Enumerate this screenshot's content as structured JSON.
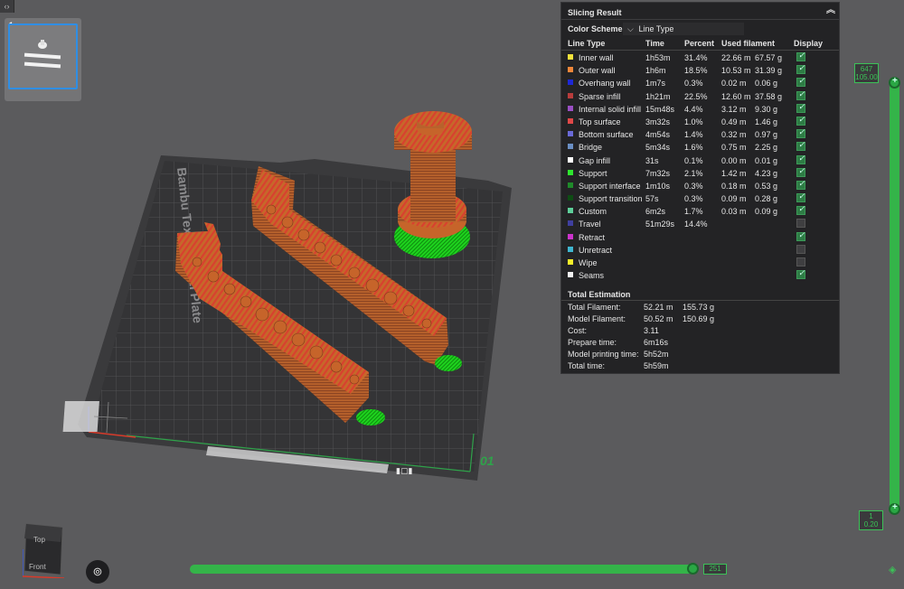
{
  "sidebar": {
    "toggle": "‹›"
  },
  "plate_thumbnail": {
    "number": "1"
  },
  "bed": {
    "label": "Bambu Textured PEI Plate",
    "plate_number": "01"
  },
  "panel": {
    "title": "Slicing Result",
    "color_scheme_label": "Color Scheme",
    "color_scheme_value": "Line Type",
    "columns": {
      "type": "Line Type",
      "time": "Time",
      "percent": "Percent",
      "used": "Used filament",
      "display": "Display"
    },
    "rows": [
      {
        "name": "Inner wall",
        "color": "#f3e23b",
        "time": "1h53m",
        "pct": "31.4%",
        "m": "22.66 m",
        "g": "67.57 g",
        "on": true
      },
      {
        "name": "Outer wall",
        "color": "#f0873a",
        "time": "1h6m",
        "pct": "18.5%",
        "m": "10.53 m",
        "g": "31.39 g",
        "on": true
      },
      {
        "name": "Overhang wall",
        "color": "#1e28d6",
        "time": "1m7s",
        "pct": "0.3%",
        "m": "0.02 m",
        "g": "0.06 g",
        "on": true
      },
      {
        "name": "Sparse infill",
        "color": "#b83c3c",
        "time": "1h21m",
        "pct": "22.5%",
        "m": "12.60 m",
        "g": "37.58 g",
        "on": true
      },
      {
        "name": "Internal solid infill",
        "color": "#9a4fc4",
        "time": "15m48s",
        "pct": "4.4%",
        "m": "3.12 m",
        "g": "9.30 g",
        "on": true
      },
      {
        "name": "Top surface",
        "color": "#e04848",
        "time": "3m32s",
        "pct": "1.0%",
        "m": "0.49 m",
        "g": "1.46 g",
        "on": true
      },
      {
        "name": "Bottom surface",
        "color": "#6a6ad8",
        "time": "4m54s",
        "pct": "1.4%",
        "m": "0.32 m",
        "g": "0.97 g",
        "on": true
      },
      {
        "name": "Bridge",
        "color": "#6a8fc4",
        "time": "5m34s",
        "pct": "1.6%",
        "m": "0.75 m",
        "g": "2.25 g",
        "on": true
      },
      {
        "name": "Gap infill",
        "color": "#ffffff",
        "time": "31s",
        "pct": "0.1%",
        "m": "0.00 m",
        "g": "0.01 g",
        "on": true
      },
      {
        "name": "Support",
        "color": "#2ee62e",
        "time": "7m32s",
        "pct": "2.1%",
        "m": "1.42 m",
        "g": "4.23 g",
        "on": true
      },
      {
        "name": "Support interface",
        "color": "#1f8a2a",
        "time": "1m10s",
        "pct": "0.3%",
        "m": "0.18 m",
        "g": "0.53 g",
        "on": true
      },
      {
        "name": "Support transition",
        "color": "#0e4d14",
        "time": "57s",
        "pct": "0.3%",
        "m": "0.09 m",
        "g": "0.28 g",
        "on": true
      },
      {
        "name": "Custom",
        "color": "#5ecf9a",
        "time": "6m2s",
        "pct": "1.7%",
        "m": "0.03 m",
        "g": "0.09 g",
        "on": true
      },
      {
        "name": "Travel",
        "color": "#3f3fa0",
        "time": "51m29s",
        "pct": "14.4%",
        "m": "",
        "g": "",
        "on": false
      },
      {
        "name": "Retract",
        "color": "#cc33cc",
        "time": "",
        "pct": "",
        "m": "",
        "g": "",
        "on": true
      },
      {
        "name": "Unretract",
        "color": "#3fb6d0",
        "time": "",
        "pct": "",
        "m": "",
        "g": "",
        "on": false
      },
      {
        "name": "Wipe",
        "color": "#f5ef2a",
        "time": "",
        "pct": "",
        "m": "",
        "g": "",
        "on": false
      },
      {
        "name": "Seams",
        "color": "#f2f2f2",
        "time": "",
        "pct": "",
        "m": "",
        "g": "",
        "on": true
      }
    ],
    "total_title": "Total Estimation",
    "totals": [
      {
        "label": "Total Filament:",
        "v1": "52.21 m",
        "v2": "155.73 g"
      },
      {
        "label": "Model Filament:",
        "v1": "50.52 m",
        "v2": "150.69 g"
      },
      {
        "label": "Cost:",
        "v1": "3.11",
        "v2": ""
      },
      {
        "label": "Prepare time:",
        "v1": "6m16s",
        "v2": ""
      },
      {
        "label": "Model printing time:",
        "v1": "5h52m",
        "v2": ""
      },
      {
        "label": "Total time:",
        "v1": "5h59m",
        "v2": ""
      }
    ]
  },
  "layer_slider": {
    "top_layer": "647",
    "top_height": "105.00",
    "bottom_layer": "1",
    "bottom_height": "0.20"
  },
  "move_slider": {
    "value": "251"
  },
  "view_cube": {
    "top": "Top",
    "front": "Front"
  }
}
